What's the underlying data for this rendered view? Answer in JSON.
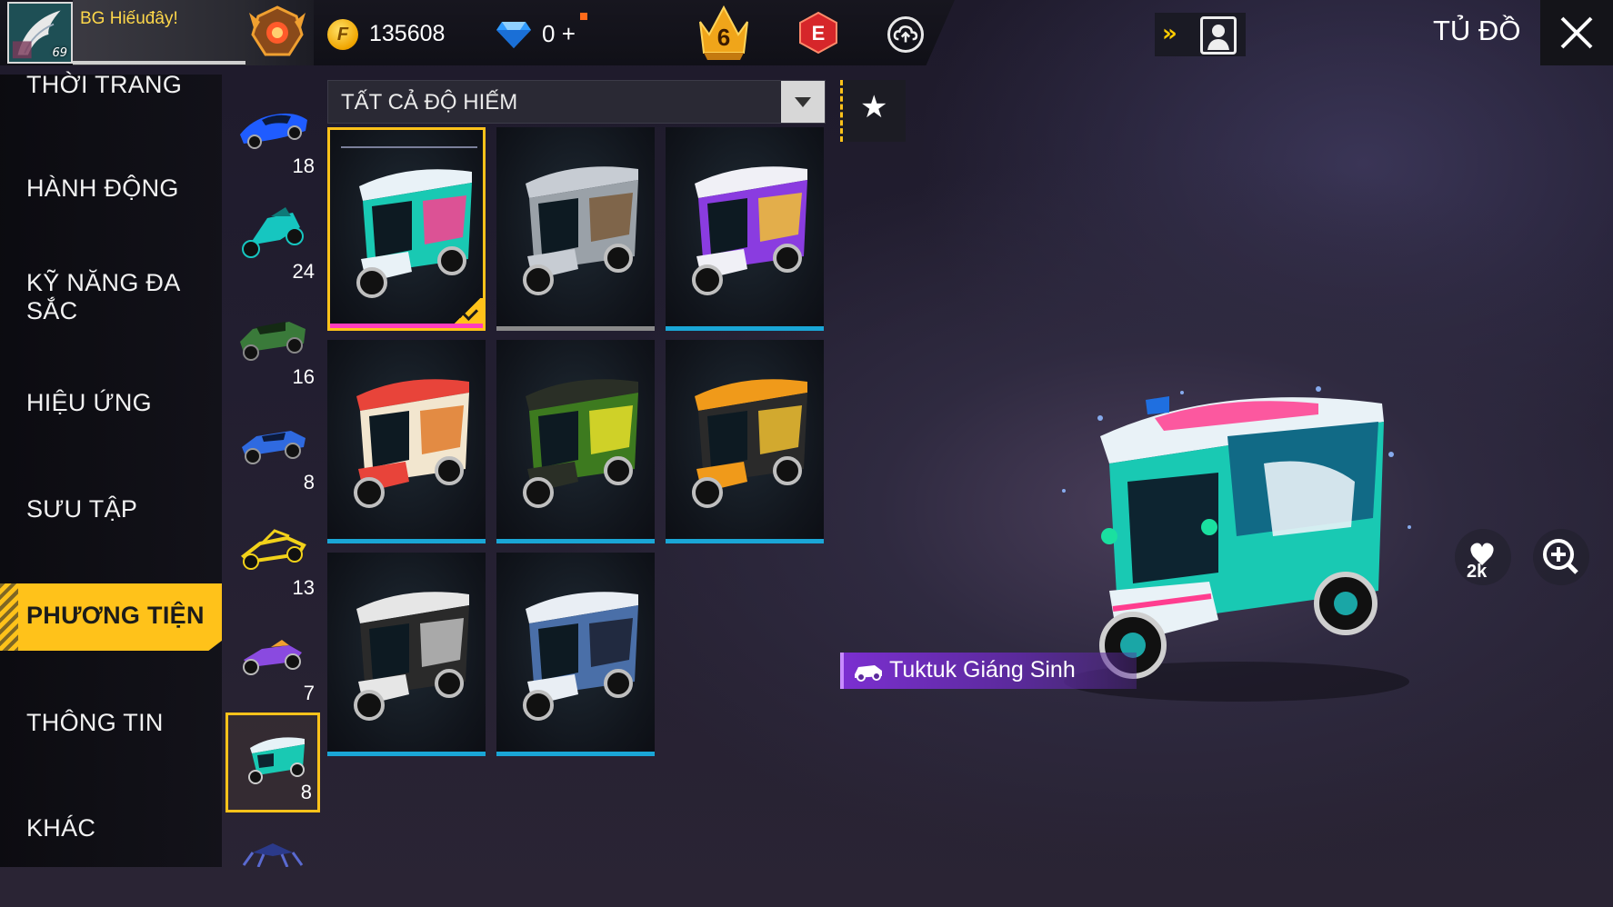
{
  "player": {
    "name": "BG  Hiếuđây!",
    "level": "69"
  },
  "currency": {
    "gold": "135608",
    "diamonds": "0",
    "diamond_plus": "+"
  },
  "badges": {
    "rank_number": "6",
    "elite_letter": "E"
  },
  "header": {
    "title": "TỦ ĐỒ",
    "fast_forward": "»"
  },
  "categories": [
    {
      "label": "THỜI TRANG"
    },
    {
      "label": "HÀNH ĐỘNG"
    },
    {
      "label": "KỸ NĂNG ĐA SẮC"
    },
    {
      "label": "HIỆU ỨNG"
    },
    {
      "label": "SƯU TẬP"
    },
    {
      "label": "PHƯƠNG TIỆN",
      "active": true
    },
    {
      "label": "THÔNG TIN"
    },
    {
      "label": "KHÁC"
    }
  ],
  "vehicle_types": [
    {
      "icon": "sports-car-icon",
      "count": "18"
    },
    {
      "icon": "motorbike-icon",
      "count": "24"
    },
    {
      "icon": "jeep-icon",
      "count": "16"
    },
    {
      "icon": "monster-truck-icon",
      "count": "8"
    },
    {
      "icon": "buggy-icon",
      "count": "13"
    },
    {
      "icon": "kart-icon",
      "count": "7"
    },
    {
      "icon": "tuktuk-icon",
      "count": "8",
      "selected": true
    },
    {
      "icon": "spider-vehicle-icon",
      "count": ""
    }
  ],
  "filter": {
    "label": "TẤT CẢ ĐỘ HIẾM"
  },
  "items": [
    {
      "name": "tuktuk-christmas",
      "roof": "#e9f2f7",
      "body": "#19c9b3",
      "accent": "#ff3d8f",
      "rarity": "#ff3dbd",
      "selected": true
    },
    {
      "name": "tuktuk-silver",
      "roof": "#c7ccd3",
      "body": "#9aa1a8",
      "accent": "#7a5a3a",
      "rarity": "#8a8a8a"
    },
    {
      "name": "tuktuk-purple",
      "roof": "#f0f0f6",
      "body": "#8a3ce0",
      "accent": "#f2c230",
      "rarity": "#1aa6d6"
    },
    {
      "name": "tuktuk-red-roof",
      "roof": "#e8443a",
      "body": "#f2e6cf",
      "accent": "#e07a2a",
      "rarity": "#1aa6d6"
    },
    {
      "name": "tuktuk-green",
      "roof": "#2a2f26",
      "body": "#3d7a1f",
      "accent": "#e9e02a",
      "rarity": "#1aa6d6"
    },
    {
      "name": "tuktuk-tiger",
      "roof": "#f09a1a",
      "body": "#2a2a2a",
      "accent": "#f0c030",
      "rarity": "#1aa6d6"
    },
    {
      "name": "tuktuk-black-white",
      "roof": "#e6e6e6",
      "body": "#2a2a2a",
      "accent": "#bfbfbf",
      "rarity": "#1aa6d6"
    },
    {
      "name": "tuktuk-camo-blue",
      "roof": "#e9eef4",
      "body": "#4a6fa8",
      "accent": "#1a1f2e",
      "rarity": "#1aa6d6"
    }
  ],
  "selected_item": {
    "name": "Tuktuk Giáng Sinh"
  },
  "social": {
    "likes": "2k"
  }
}
